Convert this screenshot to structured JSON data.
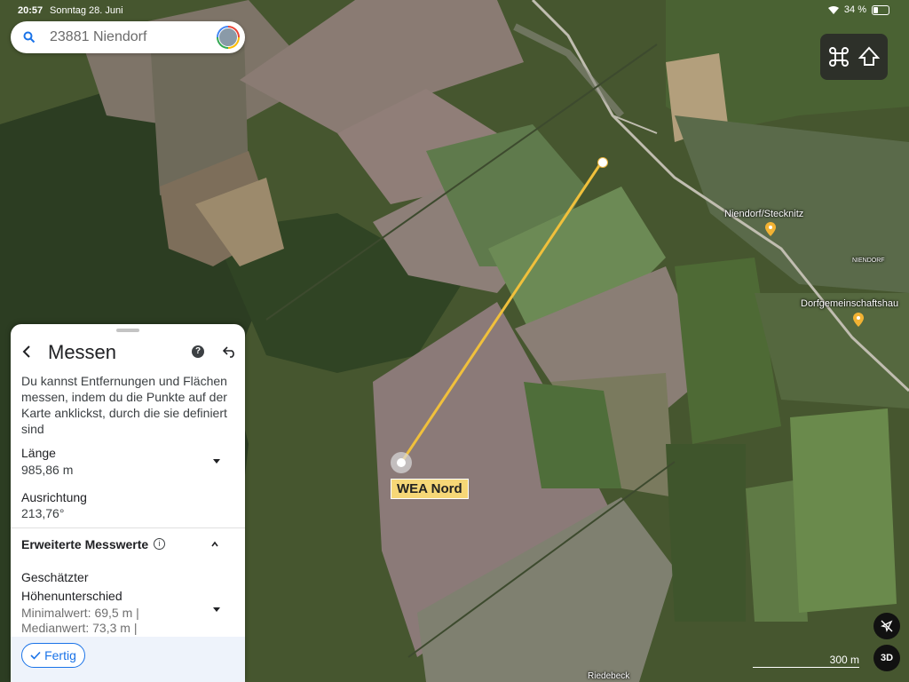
{
  "status": {
    "time": "20:57",
    "date": "Sonntag 28. Juni",
    "battery": "34 %"
  },
  "search": {
    "text": "23881 Niendorf",
    "icon": "search-icon"
  },
  "map": {
    "places": [
      {
        "name": "Niendorf/Stecknitz"
      },
      {
        "name": "Dorfgemeinschaftshau"
      }
    ],
    "small_labels": {
      "niendorf": "NIENDORF",
      "riedebeck": "Riedebeck"
    },
    "marker_label": "WEA Nord",
    "scale": "300 m",
    "view_3d": "3D",
    "line_color": "#f0c03c"
  },
  "panel": {
    "title": "Messen",
    "description": "Du kannst Entfernungen und Flächen messen, indem du die Punkte auf der Karte anklickst, durch die sie definiert sind",
    "length_label": "Länge",
    "length_value": "985,86 m",
    "heading_label": "Ausrichtung",
    "heading_value": "213,76°",
    "advanced_label": "Erweiterte Messwerte",
    "elev_label_1": "Geschätzter",
    "elev_label_2": "Höhenunterschied",
    "elev_min": "Minimalwert: 69,5 m |",
    "elev_median": "Medianwert: 73,3 m |",
    "done_label": "Fertig"
  }
}
